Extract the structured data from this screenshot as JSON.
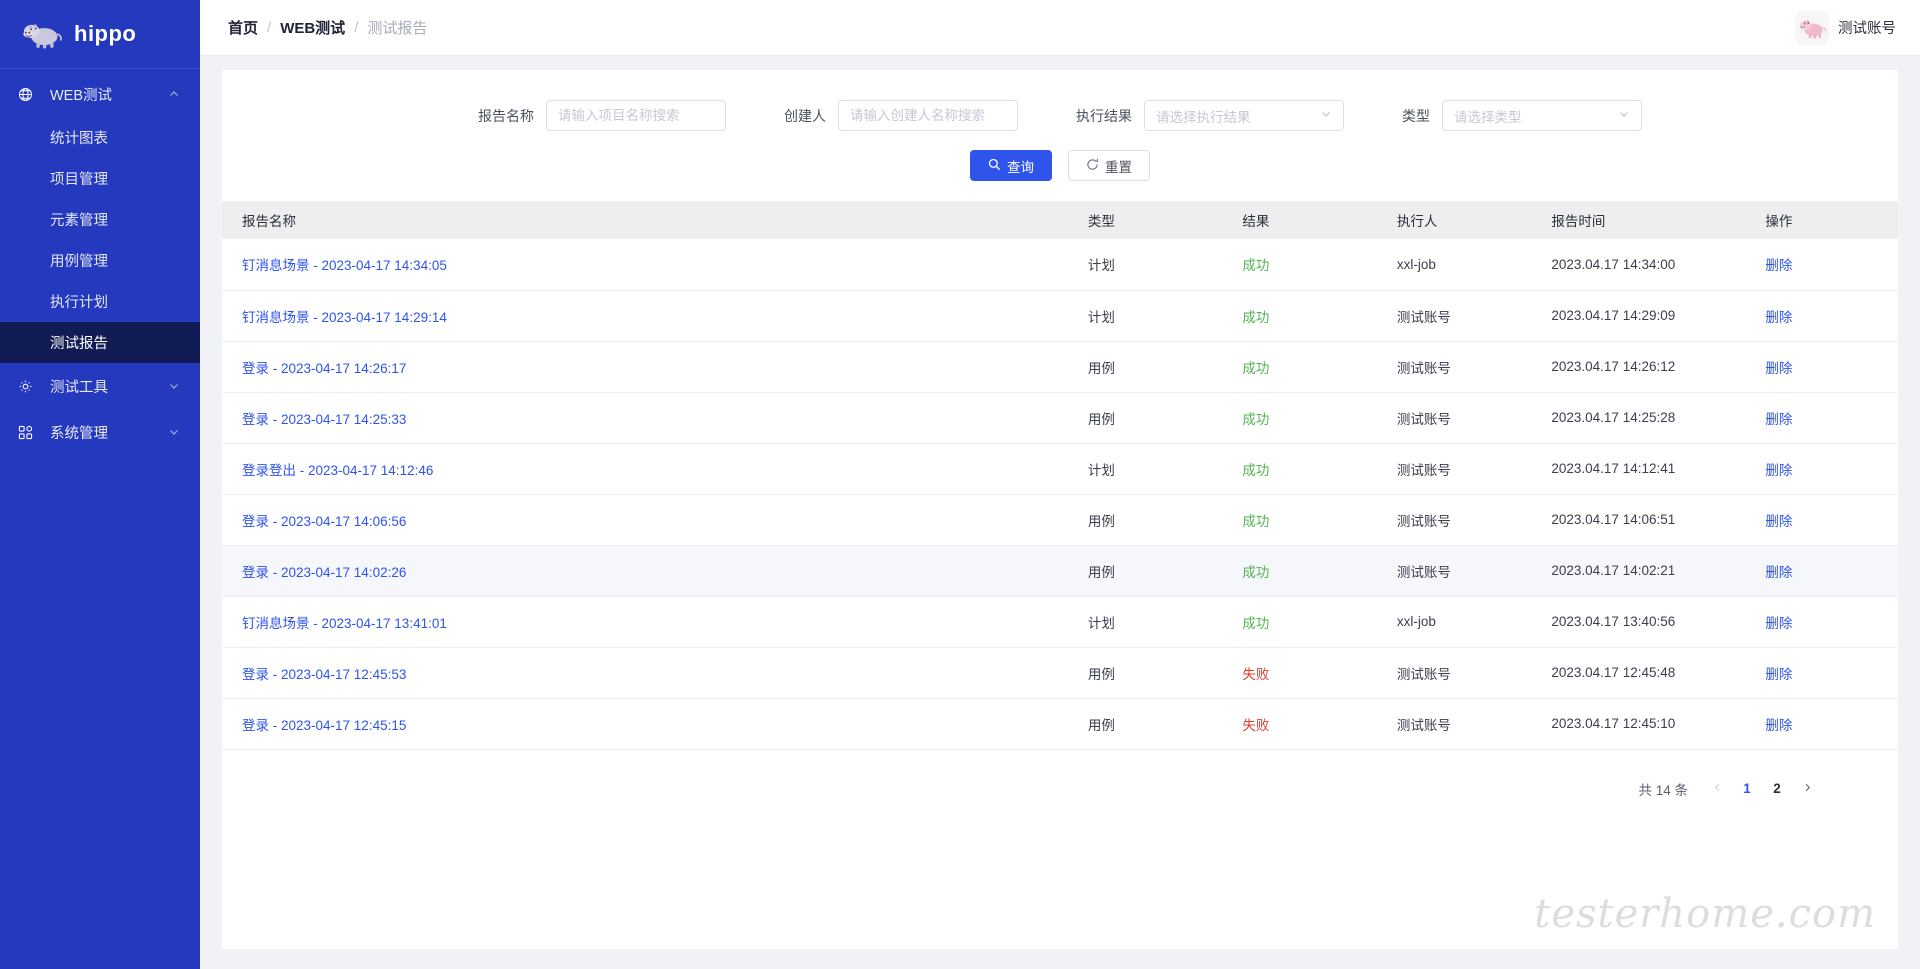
{
  "brand": {
    "name": "hippo",
    "logo_icon": "hippo-logo-icon",
    "sidebar_bg": "#2439bd",
    "active_bg": "#121c54"
  },
  "sidebar": {
    "groups": [
      {
        "label": "WEB测试",
        "icon": "globe-icon",
        "chevron": "chevron-up-icon",
        "expanded": true,
        "items": [
          {
            "label": "统计图表",
            "active": false
          },
          {
            "label": "项目管理",
            "active": false
          },
          {
            "label": "元素管理",
            "active": false
          },
          {
            "label": "用例管理",
            "active": false
          },
          {
            "label": "执行计划",
            "active": false
          },
          {
            "label": "测试报告",
            "active": true
          }
        ]
      },
      {
        "label": "测试工具",
        "icon": "gear-icon",
        "chevron": "chevron-down-icon",
        "expanded": false,
        "items": []
      },
      {
        "label": "系统管理",
        "icon": "grid-icon",
        "chevron": "chevron-down-icon",
        "expanded": false,
        "items": []
      }
    ]
  },
  "topbar": {
    "breadcrumb": [
      {
        "label": "首页",
        "current": false
      },
      {
        "label": "WEB测试",
        "current": false
      },
      {
        "label": "测试报告",
        "current": true
      }
    ],
    "separator": "/",
    "account": {
      "name": "测试账号",
      "avatar_icon": "hippo-avatar-icon"
    }
  },
  "filters": {
    "report_name": {
      "label": "报告名称",
      "placeholder": "请输入项目名称搜索",
      "value": ""
    },
    "creator": {
      "label": "创建人",
      "placeholder": "请输入创建人名称搜索",
      "value": ""
    },
    "result": {
      "label": "执行结果",
      "placeholder": "请选择执行结果",
      "value": "",
      "chevron": "chevron-down-icon"
    },
    "type": {
      "label": "类型",
      "placeholder": "请选择类型",
      "value": "",
      "chevron": "chevron-down-icon"
    },
    "buttons": {
      "query": {
        "label": "查询",
        "icon": "search-icon"
      },
      "reset": {
        "label": "重置",
        "icon": "refresh-icon"
      }
    }
  },
  "table": {
    "columns": [
      "报告名称",
      "类型",
      "结果",
      "执行人",
      "报告时间",
      "操作"
    ],
    "action_label": "删除",
    "rows": [
      {
        "name": "钉消息场景 - 2023-04-17 14:34:05",
        "type": "计划",
        "result": "成功",
        "ok": true,
        "executor": "xxl-job",
        "time": "2023.04.17 14:34:00",
        "highlight": false
      },
      {
        "name": "钉消息场景 - 2023-04-17 14:29:14",
        "type": "计划",
        "result": "成功",
        "ok": true,
        "executor": "测试账号",
        "time": "2023.04.17 14:29:09",
        "highlight": false
      },
      {
        "name": "登录 - 2023-04-17 14:26:17",
        "type": "用例",
        "result": "成功",
        "ok": true,
        "executor": "测试账号",
        "time": "2023.04.17 14:26:12",
        "highlight": false
      },
      {
        "name": "登录 - 2023-04-17 14:25:33",
        "type": "用例",
        "result": "成功",
        "ok": true,
        "executor": "测试账号",
        "time": "2023.04.17 14:25:28",
        "highlight": false
      },
      {
        "name": "登录登出 - 2023-04-17 14:12:46",
        "type": "计划",
        "result": "成功",
        "ok": true,
        "executor": "测试账号",
        "time": "2023.04.17 14:12:41",
        "highlight": false
      },
      {
        "name": "登录 - 2023-04-17 14:06:56",
        "type": "用例",
        "result": "成功",
        "ok": true,
        "executor": "测试账号",
        "time": "2023.04.17 14:06:51",
        "highlight": false
      },
      {
        "name": "登录 - 2023-04-17 14:02:26",
        "type": "用例",
        "result": "成功",
        "ok": true,
        "executor": "测试账号",
        "time": "2023.04.17 14:02:21",
        "highlight": true
      },
      {
        "name": "钉消息场景 - 2023-04-17 13:41:01",
        "type": "计划",
        "result": "成功",
        "ok": true,
        "executor": "xxl-job",
        "time": "2023.04.17 13:40:56",
        "highlight": false
      },
      {
        "name": "登录 - 2023-04-17 12:45:53",
        "type": "用例",
        "result": "失败",
        "ok": false,
        "executor": "测试账号",
        "time": "2023.04.17 12:45:48",
        "highlight": false
      },
      {
        "name": "登录 - 2023-04-17 12:45:15",
        "type": "用例",
        "result": "失败",
        "ok": false,
        "executor": "测试账号",
        "time": "2023.04.17 12:45:10",
        "highlight": false
      }
    ]
  },
  "pagination": {
    "total_text": "共 14 条",
    "prev_icon": "chevron-left-icon",
    "next_icon": "chevron-right-icon",
    "pages": [
      "1",
      "2"
    ],
    "current": "1"
  },
  "watermark": "testerhome.com",
  "colors": {
    "primary": "#2f54eb",
    "success": "#52b351",
    "danger": "#e23b2e",
    "sidebar": "#2439bd",
    "sidebar_active": "#121c54",
    "page_bg": "#f0f2f5"
  }
}
